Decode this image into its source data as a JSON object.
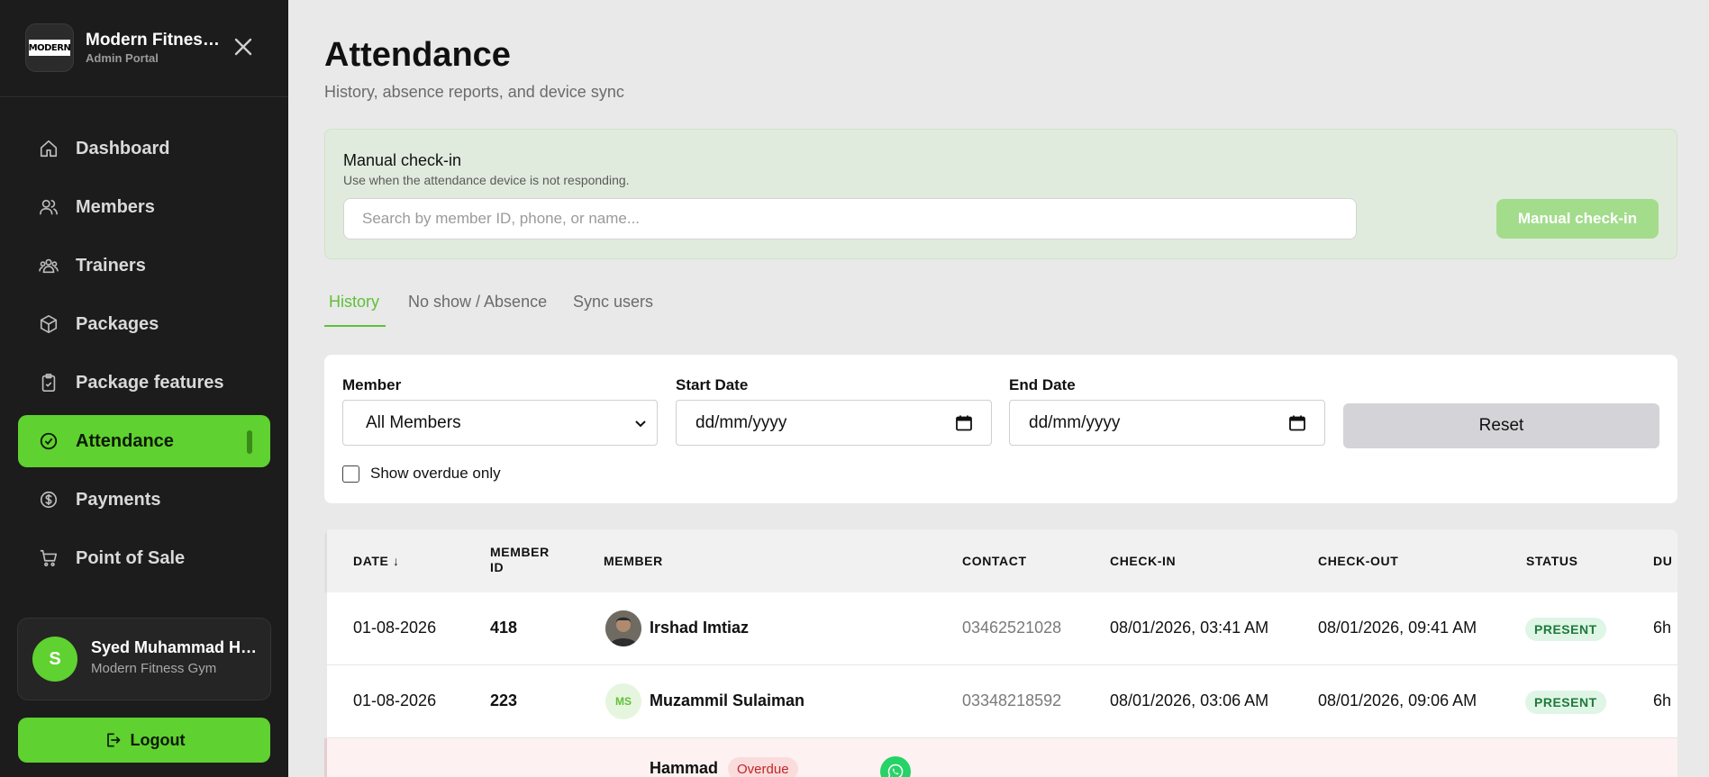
{
  "brand": {
    "name": "Modern Fitness Gym",
    "subtitle": "Admin Portal",
    "logo_text": "MODERN"
  },
  "sidebar": {
    "items": [
      {
        "label": "Dashboard",
        "icon": "home-icon"
      },
      {
        "label": "Members",
        "icon": "users-icon"
      },
      {
        "label": "Trainers",
        "icon": "group-icon"
      },
      {
        "label": "Packages",
        "icon": "box-icon"
      },
      {
        "label": "Package features",
        "icon": "clipboard-icon"
      },
      {
        "label": "Attendance",
        "icon": "check-circle-icon",
        "active": true
      },
      {
        "label": "Payments",
        "icon": "dollar-circle-icon"
      },
      {
        "label": "Point of Sale",
        "icon": "cart-icon"
      }
    ]
  },
  "user": {
    "initial": "S",
    "name": "Syed Muhammad Hamza",
    "gym": "Modern Fitness Gym"
  },
  "logout_label": "Logout",
  "page": {
    "title": "Attendance",
    "subtitle": "History, absence reports, and device sync"
  },
  "manual_checkin": {
    "title": "Manual check-in",
    "description": "Use when the attendance device is not responding.",
    "placeholder": "Search by member ID, phone, or name...",
    "button": "Manual check-in"
  },
  "tabs": [
    "History",
    "No show / Absence",
    "Sync users"
  ],
  "filters": {
    "member_label": "Member",
    "member_value": "All Members",
    "start_label": "Start Date",
    "start_value": "dd/mm/yyyy",
    "end_label": "End Date",
    "end_value": "dd/mm/yyyy",
    "reset": "Reset",
    "overdue_label": "Show overdue only"
  },
  "table": {
    "headers": [
      "DATE ↓",
      "MEMBER ID",
      "MEMBER",
      "CONTACT",
      "CHECK-IN",
      "CHECK-OUT",
      "STATUS",
      "DU"
    ],
    "rows": [
      {
        "date": "01-08-2026",
        "member_id": "418",
        "member": "Irshad Imtiaz",
        "avatar": "photo",
        "contact": "03462521028",
        "check_in": "08/01/2026, 03:41 AM",
        "check_out": "08/01/2026, 09:41 AM",
        "status": "PRESENT",
        "duration": "6h"
      },
      {
        "date": "01-08-2026",
        "member_id": "223",
        "member": "Muzammil Sulaiman",
        "avatar": "MS",
        "contact": "03348218592",
        "check_in": "08/01/2026, 03:06 AM",
        "check_out": "08/01/2026, 09:06 AM",
        "status": "PRESENT",
        "duration": "6h"
      },
      {
        "member": "Hammad",
        "overdue": "Overdue"
      }
    ]
  },
  "colors": {
    "accent": "#5fd130",
    "sidebar": "#1c1c1c",
    "present_bg": "#dff5e6",
    "overdue_bg": "#fbdcdc"
  }
}
